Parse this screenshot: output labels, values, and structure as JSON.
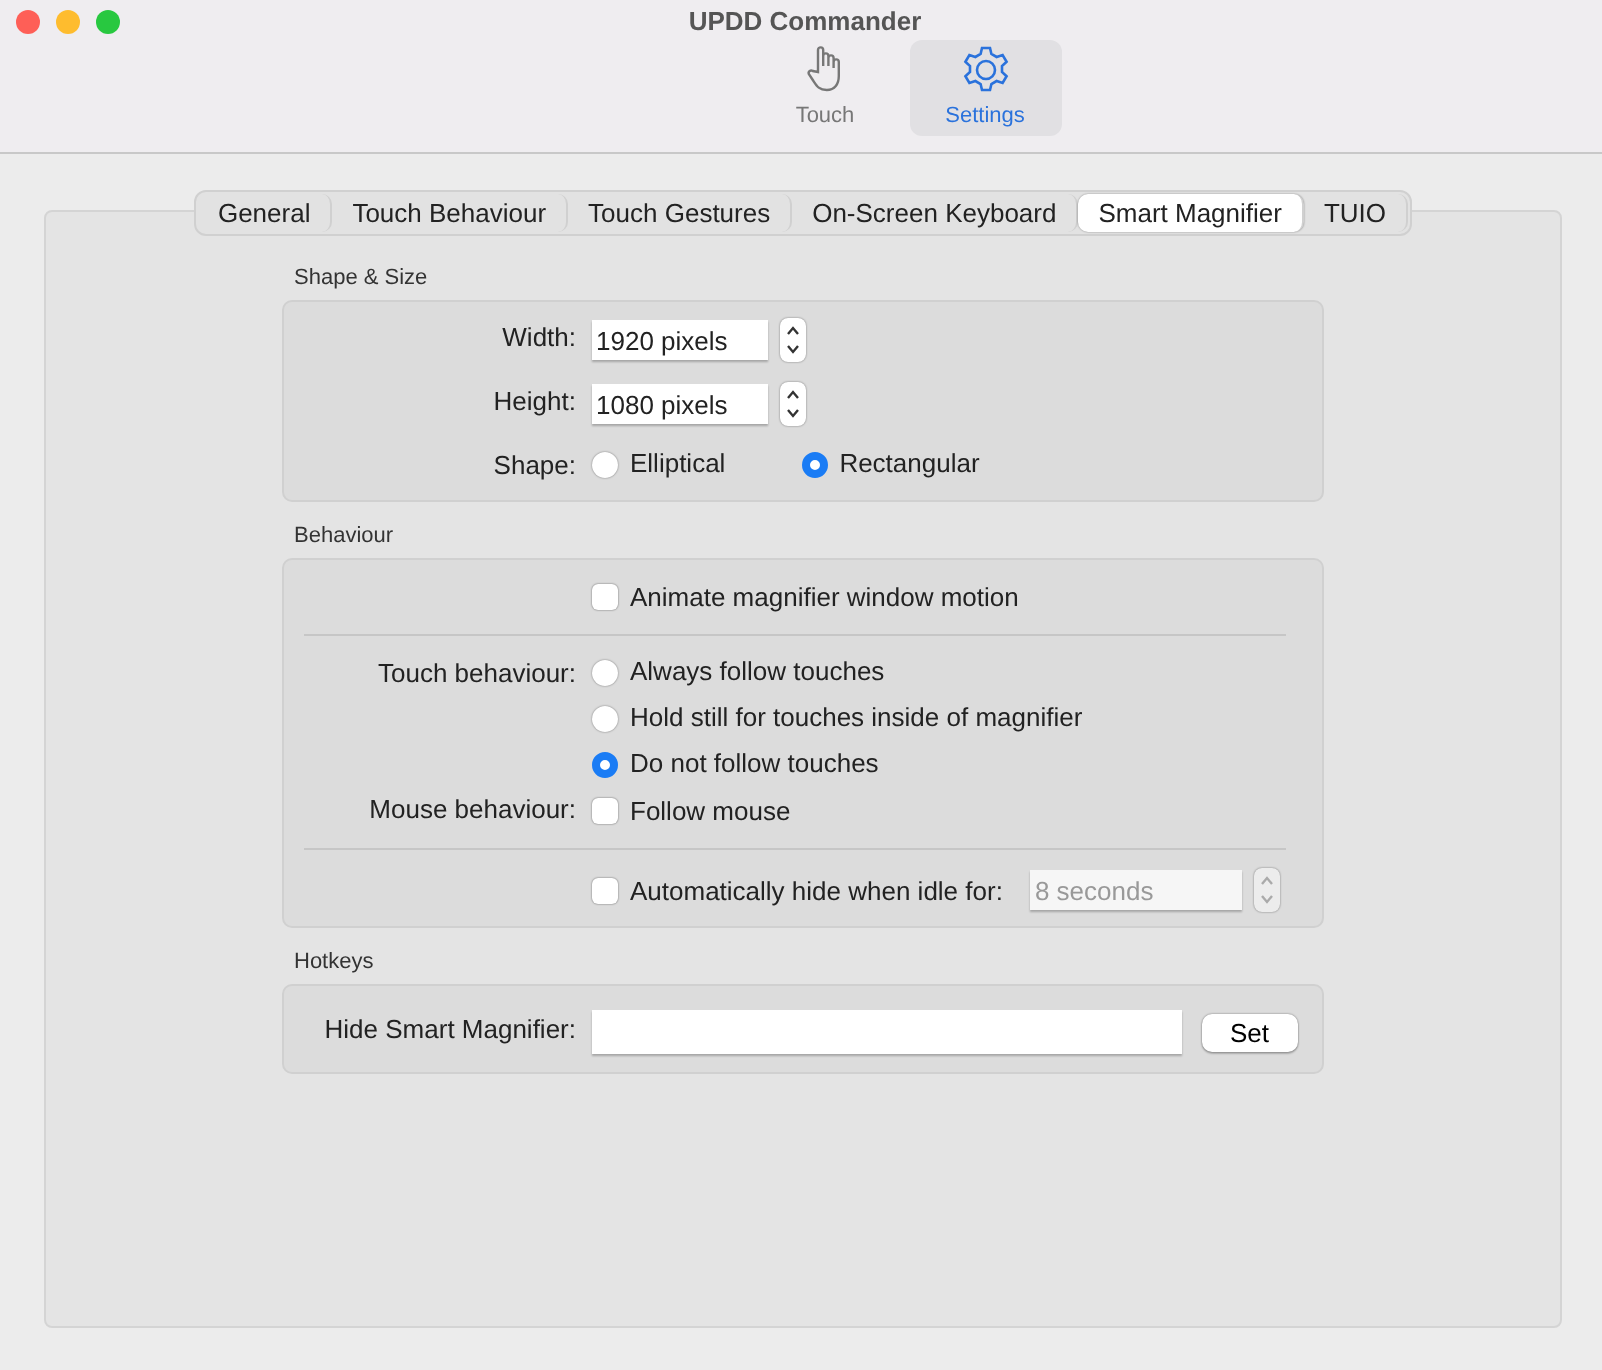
{
  "window": {
    "title": "UPDD Commander"
  },
  "toolbar": [
    {
      "label": "Touch",
      "selected": false
    },
    {
      "label": "Settings",
      "selected": true
    }
  ],
  "tabs": [
    {
      "label": "General",
      "selected": false
    },
    {
      "label": "Touch Behaviour",
      "selected": false
    },
    {
      "label": "Touch Gestures",
      "selected": false
    },
    {
      "label": "On-Screen Keyboard",
      "selected": false
    },
    {
      "label": "Smart Magnifier",
      "selected": true
    },
    {
      "label": "TUIO",
      "selected": false
    }
  ],
  "sections": [
    {
      "title": "Shape & Size",
      "rows": [
        {
          "kind": "stepper",
          "label": "Width:",
          "value": "1920 pixels"
        },
        {
          "kind": "stepper",
          "label": "Height:",
          "value": "1080 pixels"
        },
        {
          "kind": "radio_row",
          "label": "Shape:",
          "options": [
            {
              "label": "Elliptical",
              "selected": false
            },
            {
              "label": "Rectangular",
              "selected": true
            }
          ]
        }
      ]
    },
    {
      "title": "Behaviour",
      "rows": [
        {
          "kind": "checkbox",
          "text": "Animate magnifier window motion",
          "checked": false
        },
        {
          "kind": "separator"
        },
        {
          "kind": "radio_column",
          "label": "Touch behaviour:",
          "options": [
            {
              "label": "Always follow touches",
              "selected": false
            },
            {
              "label": "Hold still for touches inside of magnifier",
              "selected": false
            },
            {
              "label": "Do not follow touches",
              "selected": true
            }
          ]
        },
        {
          "kind": "checkbox",
          "label": "Mouse behaviour:",
          "text": "Follow mouse",
          "checked": false
        },
        {
          "kind": "separator"
        },
        {
          "kind": "checkbox",
          "text": "Automatically hide when idle for:",
          "checked": false,
          "field": {
            "value": "8 seconds",
            "disabled": true
          }
        }
      ]
    },
    {
      "title": "Hotkeys",
      "rows": [
        {
          "kind": "hotkey",
          "label": "Hide Smart Magnifier:",
          "button": "Set"
        }
      ]
    }
  ]
}
